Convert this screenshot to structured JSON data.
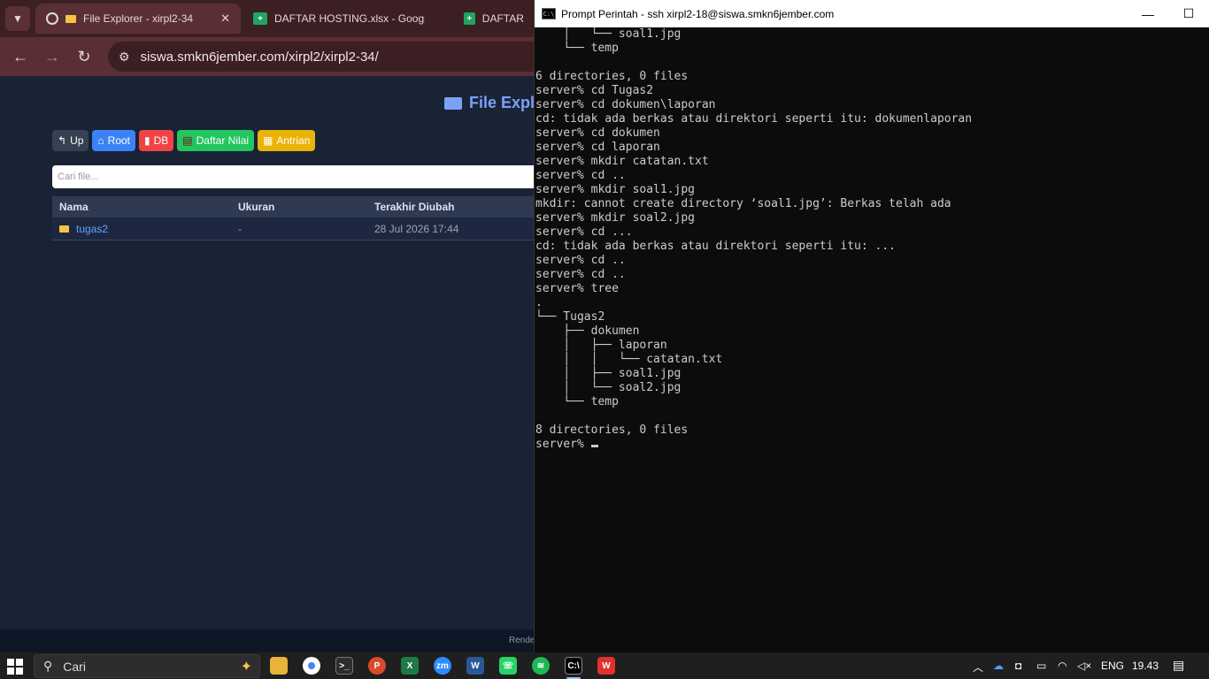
{
  "browser": {
    "tabs": [
      {
        "title": "File Explorer - xirpl2-34",
        "icon": "folder-favicon"
      },
      {
        "title": "DAFTAR HOSTING.xlsx - Google",
        "icon": "sheets-favicon"
      },
      {
        "title": "DAFTAR H",
        "icon": "sheets-favicon"
      }
    ],
    "url": "siswa.smkn6jember.com/xirpl2/xirpl2-34/"
  },
  "page": {
    "title": "File Expl",
    "buttons": [
      {
        "label": "Up",
        "icon": "up-arrow-icon",
        "color": "#374151"
      },
      {
        "label": "Root",
        "icon": "home-icon",
        "color": "#3b82f6"
      },
      {
        "label": "DB",
        "icon": "database-icon",
        "color": "#ef4444"
      },
      {
        "label": "Daftar Nilai",
        "icon": "ledger-icon",
        "color": "#22c55e"
      },
      {
        "label": "Antrian",
        "icon": "memo-icon",
        "color": "#eab308"
      }
    ],
    "search_placeholder": "Cari file...",
    "table": {
      "headers": [
        "Nama",
        "Ukuran",
        "Terakhir Diubah"
      ],
      "rows": [
        {
          "name": "tugas2",
          "size": "-",
          "modified": "28 Jul 2026 17:44"
        }
      ]
    },
    "footer_text": "Rende"
  },
  "terminal": {
    "title": "Prompt Perintah - ssh  xirpl2-18@siswa.smkn6jember.com",
    "lines": [
      "    │   └── soal1.jpg",
      "    └── temp",
      "",
      "6 directories, 0 files",
      "server% cd Tugas2",
      "server% cd dokumen\\laporan",
      "cd: tidak ada berkas atau direktori seperti itu: dokumenlaporan",
      "server% cd dokumen",
      "server% cd laporan",
      "server% mkdir catatan.txt",
      "server% cd ..",
      "server% mkdir soal1.jpg",
      "mkdir: cannot create directory ‘soal1.jpg’: Berkas telah ada",
      "server% mkdir soal2.jpg",
      "server% cd ...",
      "cd: tidak ada berkas atau direktori seperti itu: ...",
      "server% cd ..",
      "server% cd ..",
      "server% tree",
      ".",
      "└── Tugas2",
      "    ├── dokumen",
      "    │   ├── laporan",
      "    │   │   └── catatan.txt",
      "    │   ├── soal1.jpg",
      "    │   └── soal2.jpg",
      "    └── temp",
      "",
      "8 directories, 0 files"
    ],
    "prompt": "server% "
  },
  "taskbar": {
    "search_label": "Cari",
    "apps": [
      "file-explorer",
      "chrome",
      "terminal",
      "wps-presentation",
      "excel",
      "zoom",
      "word",
      "whatsapp",
      "spotify",
      "command-prompt",
      "wps-office"
    ],
    "lang": "ENG",
    "time": "19.43"
  }
}
